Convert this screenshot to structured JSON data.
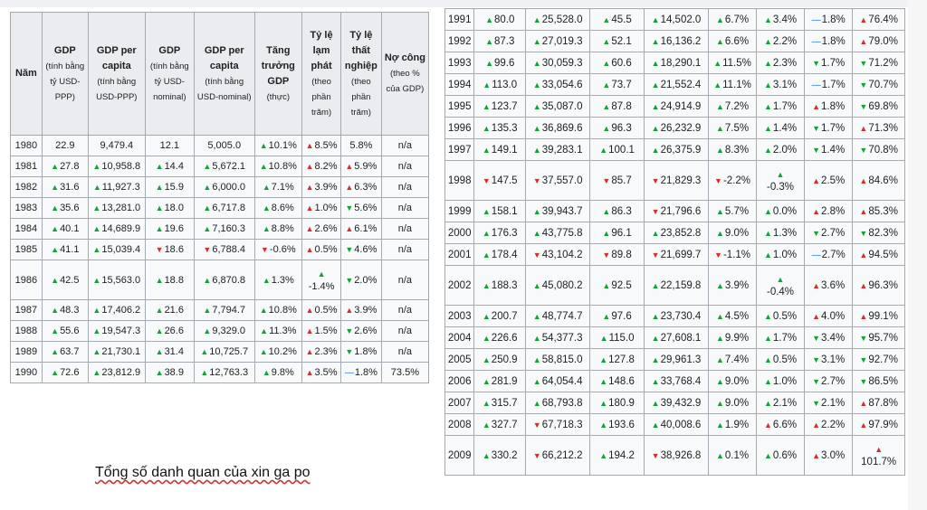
{
  "left_table": {
    "headers": [
      {
        "title": "Năm",
        "sub": ""
      },
      {
        "title": "GDP",
        "sub": "(tính bằng tỷ USD-PPP)"
      },
      {
        "title": "GDP per capita",
        "sub": "(tính bằng USD-PPP)"
      },
      {
        "title": "GDP",
        "sub": "(tính bằng tỷ USD-nominal)"
      },
      {
        "title": "GDP per capita",
        "sub": "(tính bằng USD-nominal)"
      },
      {
        "title": "Tăng trưởng GDP",
        "sub": "(thực)"
      },
      {
        "title": "Tỷ lệ lạm phát",
        "sub": "(theo phần trăm)"
      },
      {
        "title": "Tỷ lệ thất nghiệp",
        "sub": "(theo phần trăm)"
      },
      {
        "title": "Nợ công",
        "sub": "(theo % của GDP)"
      }
    ],
    "rows": [
      {
        "year": "1980",
        "gdp_ppp": [
          "",
          "22.9"
        ],
        "gdppc_ppp": [
          "",
          "9,479.4"
        ],
        "gdp_nom": [
          "",
          "12.1"
        ],
        "gdppc_nom": [
          "",
          "5,005.0"
        ],
        "growth": [
          "up",
          "10.1%"
        ],
        "inflation": [
          "up-red",
          "8.5%"
        ],
        "unemployment": [
          "",
          "5.8%"
        ],
        "debt": [
          "",
          "n/a"
        ]
      },
      {
        "year": "1981",
        "gdp_ppp": [
          "up",
          "27.8"
        ],
        "gdppc_ppp": [
          "up",
          "10,958.8"
        ],
        "gdp_nom": [
          "up",
          "14.4"
        ],
        "gdppc_nom": [
          "up",
          "5,672.1"
        ],
        "growth": [
          "up",
          "10.8%"
        ],
        "inflation": [
          "up-red",
          "8.2%"
        ],
        "unemployment": [
          "up-red",
          "5.9%"
        ],
        "debt": [
          "",
          "n/a"
        ]
      },
      {
        "year": "1982",
        "gdp_ppp": [
          "up",
          "31.6"
        ],
        "gdppc_ppp": [
          "up",
          "11,927.3"
        ],
        "gdp_nom": [
          "up",
          "15.9"
        ],
        "gdppc_nom": [
          "up",
          "6,000.0"
        ],
        "growth": [
          "up",
          "7.1%"
        ],
        "inflation": [
          "up-red",
          "3.9%"
        ],
        "unemployment": [
          "up-red",
          "6.3%"
        ],
        "debt": [
          "",
          "n/a"
        ]
      },
      {
        "year": "1983",
        "gdp_ppp": [
          "up",
          "35.6"
        ],
        "gdppc_ppp": [
          "up",
          "13,281.0"
        ],
        "gdp_nom": [
          "up",
          "18.0"
        ],
        "gdppc_nom": [
          "up",
          "6,717.8"
        ],
        "growth": [
          "up",
          "8.6%"
        ],
        "inflation": [
          "up-red",
          "1.0%"
        ],
        "unemployment": [
          "down-green",
          "5.6%"
        ],
        "debt": [
          "",
          "n/a"
        ]
      },
      {
        "year": "1984",
        "gdp_ppp": [
          "up",
          "40.1"
        ],
        "gdppc_ppp": [
          "up",
          "14,689.9"
        ],
        "gdp_nom": [
          "up",
          "19.6"
        ],
        "gdppc_nom": [
          "up",
          "7,160.3"
        ],
        "growth": [
          "up",
          "8.8%"
        ],
        "inflation": [
          "up-red",
          "2.6%"
        ],
        "unemployment": [
          "up-red",
          "6.1%"
        ],
        "debt": [
          "",
          "n/a"
        ]
      },
      {
        "year": "1985",
        "gdp_ppp": [
          "up",
          "41.1"
        ],
        "gdppc_ppp": [
          "up",
          "15,039.4"
        ],
        "gdp_nom": [
          "down",
          "18.6"
        ],
        "gdppc_nom": [
          "down",
          "6,788.4"
        ],
        "growth": [
          "down",
          "-0.6%"
        ],
        "inflation": [
          "up-red",
          "0.5%"
        ],
        "unemployment": [
          "down-green",
          "4.6%"
        ],
        "debt": [
          "",
          "n/a"
        ]
      },
      {
        "year": "1986",
        "gdp_ppp": [
          "up",
          "42.5"
        ],
        "gdppc_ppp": [
          "up",
          "15,563.0"
        ],
        "gdp_nom": [
          "up",
          "18.8"
        ],
        "gdppc_nom": [
          "up",
          "6,870.8"
        ],
        "growth": [
          "up",
          "1.3%"
        ],
        "inflation": [
          "stack-up",
          "-1.4%"
        ],
        "unemployment": [
          "down-green",
          "2.0%"
        ],
        "debt": [
          "",
          "n/a"
        ]
      },
      {
        "year": "1987",
        "gdp_ppp": [
          "up",
          "48.3"
        ],
        "gdppc_ppp": [
          "up",
          "17,406.2"
        ],
        "gdp_nom": [
          "up",
          "21.6"
        ],
        "gdppc_nom": [
          "up",
          "7,794.7"
        ],
        "growth": [
          "up",
          "10.8%"
        ],
        "inflation": [
          "up-red",
          "0.5%"
        ],
        "unemployment": [
          "up-red",
          "3.9%"
        ],
        "debt": [
          "",
          "n/a"
        ]
      },
      {
        "year": "1988",
        "gdp_ppp": [
          "up",
          "55.6"
        ],
        "gdppc_ppp": [
          "up",
          "19,547.3"
        ],
        "gdp_nom": [
          "up",
          "26.6"
        ],
        "gdppc_nom": [
          "up",
          "9,329.0"
        ],
        "growth": [
          "up",
          "11.3%"
        ],
        "inflation": [
          "up-red",
          "1.5%"
        ],
        "unemployment": [
          "down-green",
          "2.6%"
        ],
        "debt": [
          "",
          "n/a"
        ]
      },
      {
        "year": "1989",
        "gdp_ppp": [
          "up",
          "63.7"
        ],
        "gdppc_ppp": [
          "up",
          "21,730.1"
        ],
        "gdp_nom": [
          "up",
          "31.4"
        ],
        "gdppc_nom": [
          "up",
          "10,725.7"
        ],
        "growth": [
          "up",
          "10.2%"
        ],
        "inflation": [
          "up-red",
          "2.3%"
        ],
        "unemployment": [
          "down-green",
          "1.8%"
        ],
        "debt": [
          "",
          "n/a"
        ]
      },
      {
        "year": "1990",
        "gdp_ppp": [
          "up",
          "72.6"
        ],
        "gdppc_ppp": [
          "up",
          "23,812.9"
        ],
        "gdp_nom": [
          "up",
          "38.9"
        ],
        "gdppc_nom": [
          "up",
          "12,763.3"
        ],
        "growth": [
          "up",
          "9.8%"
        ],
        "inflation": [
          "up-red",
          "3.5%"
        ],
        "unemployment": [
          "steady",
          "1.8%"
        ],
        "debt": [
          "",
          "73.5%"
        ]
      }
    ]
  },
  "right_table": {
    "rows": [
      {
        "year": "1991",
        "gdp_ppp": [
          "up",
          "80.0"
        ],
        "gdppc_ppp": [
          "up",
          "25,528.0"
        ],
        "gdp_nom": [
          "up",
          "45.5"
        ],
        "gdppc_nom": [
          "up",
          "14,502.0"
        ],
        "growth": [
          "up",
          "6.7%"
        ],
        "inflation": [
          "up",
          "3.4%"
        ],
        "unemployment": [
          "steady",
          "1.8%"
        ],
        "debt": [
          "up-red",
          "76.4%"
        ]
      },
      {
        "year": "1992",
        "gdp_ppp": [
          "up",
          "87.3"
        ],
        "gdppc_ppp": [
          "up",
          "27,019.3"
        ],
        "gdp_nom": [
          "up",
          "52.1"
        ],
        "gdppc_nom": [
          "up",
          "16,136.2"
        ],
        "growth": [
          "up",
          "6.6%"
        ],
        "inflation": [
          "up",
          "2.2%"
        ],
        "unemployment": [
          "steady",
          "1.8%"
        ],
        "debt": [
          "up-red",
          "79.0%"
        ]
      },
      {
        "year": "1993",
        "gdp_ppp": [
          "up",
          "99.6"
        ],
        "gdppc_ppp": [
          "up",
          "30,059.3"
        ],
        "gdp_nom": [
          "up",
          "60.6"
        ],
        "gdppc_nom": [
          "up",
          "18,290.1"
        ],
        "growth": [
          "up",
          "11.5%"
        ],
        "inflation": [
          "up",
          "2.3%"
        ],
        "unemployment": [
          "down-green",
          "1.7%"
        ],
        "debt": [
          "down-green",
          "71.2%"
        ]
      },
      {
        "year": "1994",
        "gdp_ppp": [
          "up",
          "113.0"
        ],
        "gdppc_ppp": [
          "up",
          "33,054.6"
        ],
        "gdp_nom": [
          "up",
          "73.7"
        ],
        "gdppc_nom": [
          "up",
          "21,552.4"
        ],
        "growth": [
          "up",
          "11.1%"
        ],
        "inflation": [
          "up",
          "3.1%"
        ],
        "unemployment": [
          "steady",
          "1.7%"
        ],
        "debt": [
          "down-green",
          "70.7%"
        ]
      },
      {
        "year": "1995",
        "gdp_ppp": [
          "up",
          "123.7"
        ],
        "gdppc_ppp": [
          "up",
          "35,087.0"
        ],
        "gdp_nom": [
          "up",
          "87.8"
        ],
        "gdppc_nom": [
          "up",
          "24,914.9"
        ],
        "growth": [
          "up",
          "7.2%"
        ],
        "inflation": [
          "up",
          "1.7%"
        ],
        "unemployment": [
          "up-red",
          "1.8%"
        ],
        "debt": [
          "down-green",
          "69.8%"
        ]
      },
      {
        "year": "1996",
        "gdp_ppp": [
          "up",
          "135.3"
        ],
        "gdppc_ppp": [
          "up",
          "36,869.6"
        ],
        "gdp_nom": [
          "up",
          "96.3"
        ],
        "gdppc_nom": [
          "up",
          "26,232.9"
        ],
        "growth": [
          "up",
          "7.5%"
        ],
        "inflation": [
          "up",
          "1.4%"
        ],
        "unemployment": [
          "down-green",
          "1.7%"
        ],
        "debt": [
          "up-red",
          "71.3%"
        ]
      },
      {
        "year": "1997",
        "gdp_ppp": [
          "up",
          "149.1"
        ],
        "gdppc_ppp": [
          "up",
          "39,283.1"
        ],
        "gdp_nom": [
          "up",
          "100.1"
        ],
        "gdppc_nom": [
          "up",
          "26,375.9"
        ],
        "growth": [
          "up",
          "8.3%"
        ],
        "inflation": [
          "up",
          "2.0%"
        ],
        "unemployment": [
          "down-green",
          "1.4%"
        ],
        "debt": [
          "down-green",
          "70.8%"
        ]
      },
      {
        "year": "1998",
        "gdp_ppp": [
          "down",
          "147.5"
        ],
        "gdppc_ppp": [
          "down",
          "37,557.0"
        ],
        "gdp_nom": [
          "down",
          "85.7"
        ],
        "gdppc_nom": [
          "down",
          "21,829.3"
        ],
        "growth": [
          "down",
          "-2.2%"
        ],
        "inflation": [
          "stack-up",
          "-0.3%"
        ],
        "unemployment": [
          "up-red",
          "2.5%"
        ],
        "debt": [
          "up-red",
          "84.6%"
        ]
      },
      {
        "year": "1999",
        "gdp_ppp": [
          "up",
          "158.1"
        ],
        "gdppc_ppp": [
          "up",
          "39,943.7"
        ],
        "gdp_nom": [
          "up",
          "86.3"
        ],
        "gdppc_nom": [
          "down",
          "21,796.6"
        ],
        "growth": [
          "up",
          "5.7%"
        ],
        "inflation": [
          "up",
          "0.0%"
        ],
        "unemployment": [
          "up-red",
          "2.8%"
        ],
        "debt": [
          "up-red",
          "85.3%"
        ]
      },
      {
        "year": "2000",
        "gdp_ppp": [
          "up",
          "176.3"
        ],
        "gdppc_ppp": [
          "up",
          "43,775.8"
        ],
        "gdp_nom": [
          "up",
          "96.1"
        ],
        "gdppc_nom": [
          "up",
          "23,852.8"
        ],
        "growth": [
          "up",
          "9.0%"
        ],
        "inflation": [
          "up",
          "1.3%"
        ],
        "unemployment": [
          "down-green",
          "2.7%"
        ],
        "debt": [
          "down-green",
          "82.3%"
        ]
      },
      {
        "year": "2001",
        "gdp_ppp": [
          "up",
          "178.4"
        ],
        "gdppc_ppp": [
          "down",
          "43,104.2"
        ],
        "gdp_nom": [
          "down",
          "89.8"
        ],
        "gdppc_nom": [
          "down",
          "21,699.7"
        ],
        "growth": [
          "down",
          "-1.1%"
        ],
        "inflation": [
          "up",
          "1.0%"
        ],
        "unemployment": [
          "steady",
          "2.7%"
        ],
        "debt": [
          "up-red",
          "94.5%"
        ]
      },
      {
        "year": "2002",
        "gdp_ppp": [
          "up",
          "188.3"
        ],
        "gdppc_ppp": [
          "up",
          "45,080.2"
        ],
        "gdp_nom": [
          "up",
          "92.5"
        ],
        "gdppc_nom": [
          "up",
          "22,159.8"
        ],
        "growth": [
          "up",
          "3.9%"
        ],
        "inflation": [
          "stack-up",
          "-0.4%"
        ],
        "unemployment": [
          "up-red",
          "3.6%"
        ],
        "debt": [
          "up-red",
          "96.3%"
        ]
      },
      {
        "year": "2003",
        "gdp_ppp": [
          "up",
          "200.7"
        ],
        "gdppc_ppp": [
          "up",
          "48,774.7"
        ],
        "gdp_nom": [
          "up",
          "97.6"
        ],
        "gdppc_nom": [
          "up",
          "23,730.4"
        ],
        "growth": [
          "up",
          "4.5%"
        ],
        "inflation": [
          "up",
          "0.5%"
        ],
        "unemployment": [
          "up-red",
          "4.0%"
        ],
        "debt": [
          "up-red",
          "99.1%"
        ]
      },
      {
        "year": "2004",
        "gdp_ppp": [
          "up",
          "226.6"
        ],
        "gdppc_ppp": [
          "up",
          "54,377.3"
        ],
        "gdp_nom": [
          "up",
          "115.0"
        ],
        "gdppc_nom": [
          "up",
          "27,608.1"
        ],
        "growth": [
          "up",
          "9.9%"
        ],
        "inflation": [
          "up",
          "1.7%"
        ],
        "unemployment": [
          "down-green",
          "3.4%"
        ],
        "debt": [
          "down-green",
          "95.7%"
        ]
      },
      {
        "year": "2005",
        "gdp_ppp": [
          "up",
          "250.9"
        ],
        "gdppc_ppp": [
          "up",
          "58,815.0"
        ],
        "gdp_nom": [
          "up",
          "127.8"
        ],
        "gdppc_nom": [
          "up",
          "29,961.3"
        ],
        "growth": [
          "up",
          "7.4%"
        ],
        "inflation": [
          "up",
          "0.5%"
        ],
        "unemployment": [
          "down-green",
          "3.1%"
        ],
        "debt": [
          "down-green",
          "92.7%"
        ]
      },
      {
        "year": "2006",
        "gdp_ppp": [
          "up",
          "281.9"
        ],
        "gdppc_ppp": [
          "up",
          "64,054.4"
        ],
        "gdp_nom": [
          "up",
          "148.6"
        ],
        "gdppc_nom": [
          "up",
          "33,768.4"
        ],
        "growth": [
          "up",
          "9.0%"
        ],
        "inflation": [
          "up",
          "1.0%"
        ],
        "unemployment": [
          "down-green",
          "2.7%"
        ],
        "debt": [
          "down-green",
          "86.5%"
        ]
      },
      {
        "year": "2007",
        "gdp_ppp": [
          "up",
          "315.7"
        ],
        "gdppc_ppp": [
          "up",
          "68,793.8"
        ],
        "gdp_nom": [
          "up",
          "180.9"
        ],
        "gdppc_nom": [
          "up",
          "39,432.9"
        ],
        "growth": [
          "up",
          "9.0%"
        ],
        "inflation": [
          "up",
          "2.1%"
        ],
        "unemployment": [
          "down-green",
          "2.1%"
        ],
        "debt": [
          "up-red",
          "87.8%"
        ]
      },
      {
        "year": "2008",
        "gdp_ppp": [
          "up",
          "327.7"
        ],
        "gdppc_ppp": [
          "down",
          "67,718.3"
        ],
        "gdp_nom": [
          "up",
          "193.6"
        ],
        "gdppc_nom": [
          "up",
          "40,008.6"
        ],
        "growth": [
          "up",
          "1.9%"
        ],
        "inflation": [
          "up-red",
          "6.6%"
        ],
        "unemployment": [
          "up-red",
          "2.2%"
        ],
        "debt": [
          "up-red",
          "97.9%"
        ]
      },
      {
        "year": "2009",
        "gdp_ppp": [
          "up",
          "330.2"
        ],
        "gdppc_ppp": [
          "down",
          "66,212.2"
        ],
        "gdp_nom": [
          "up",
          "194.2"
        ],
        "gdppc_nom": [
          "down",
          "38,926.8"
        ],
        "growth": [
          "up",
          "0.1%"
        ],
        "inflation": [
          "up",
          "0.6%"
        ],
        "unemployment": [
          "up-red",
          "3.0%"
        ],
        "debt": [
          "stack-red",
          "101.7%"
        ]
      }
    ]
  },
  "caption": "Tổng số danh quan của xin ga po",
  "colors": {
    "up_green": "#14a03a",
    "down_red": "#d32f2f",
    "steady_blue": "#1a73e8",
    "header_bg": "#eaecf0",
    "cell_bg": "#f8f9fa",
    "border": "#a2a9b1"
  },
  "icons": {
    "up": "triangle-up-icon",
    "down": "triangle-down-icon",
    "steady": "dash-icon"
  }
}
